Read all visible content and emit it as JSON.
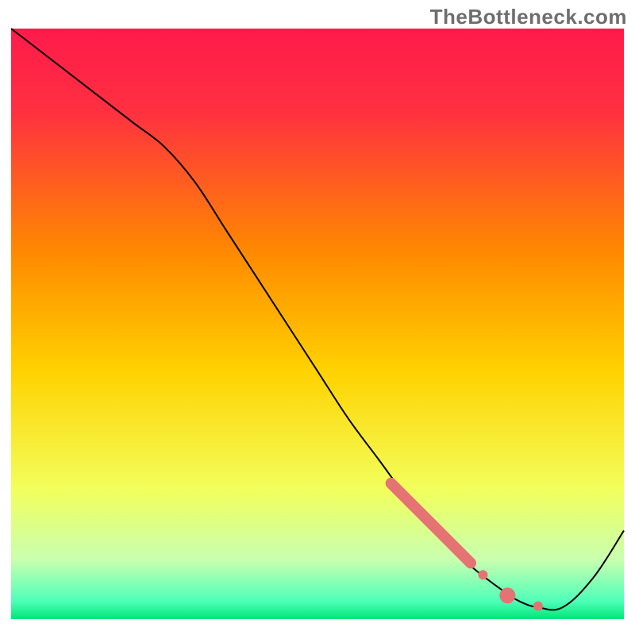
{
  "watermark": "TheBottleneck.com",
  "chart_data": {
    "type": "line",
    "title": "",
    "xlabel": "",
    "ylabel": "",
    "xlim": [
      0,
      100
    ],
    "ylim": [
      0,
      100
    ],
    "gradient_top_color": "#ff1a4b",
    "gradient_mid_color": "#ffd200",
    "gradient_bottom_color": "#00e676",
    "background_white_border": true,
    "series": [
      {
        "name": "bottleneck-curve",
        "color": "#000000",
        "stroke_width": 2,
        "x": [
          0,
          5,
          10,
          15,
          20,
          25,
          30,
          35,
          40,
          45,
          50,
          55,
          60,
          65,
          70,
          75,
          80,
          83,
          86,
          90,
          95,
          100
        ],
        "y": [
          100,
          96,
          92,
          88,
          84,
          80,
          74,
          66,
          58,
          50,
          42,
          34,
          27,
          20,
          14,
          9,
          5,
          3,
          2,
          2,
          7,
          15
        ]
      },
      {
        "name": "highlight-segment",
        "color": "#e57373",
        "stroke_width": 14,
        "linecap": "round",
        "x": [
          62,
          75
        ],
        "y": [
          23,
          9.5
        ]
      }
    ],
    "markers": [
      {
        "name": "dot-a",
        "x": 77,
        "y": 7.5,
        "r": 6,
        "color": "#e57373"
      },
      {
        "name": "dot-b",
        "x": 81,
        "y": 4.0,
        "r": 10,
        "color": "#e57373"
      },
      {
        "name": "dot-c",
        "x": 86,
        "y": 2.2,
        "r": 6,
        "color": "#e57373"
      }
    ]
  }
}
